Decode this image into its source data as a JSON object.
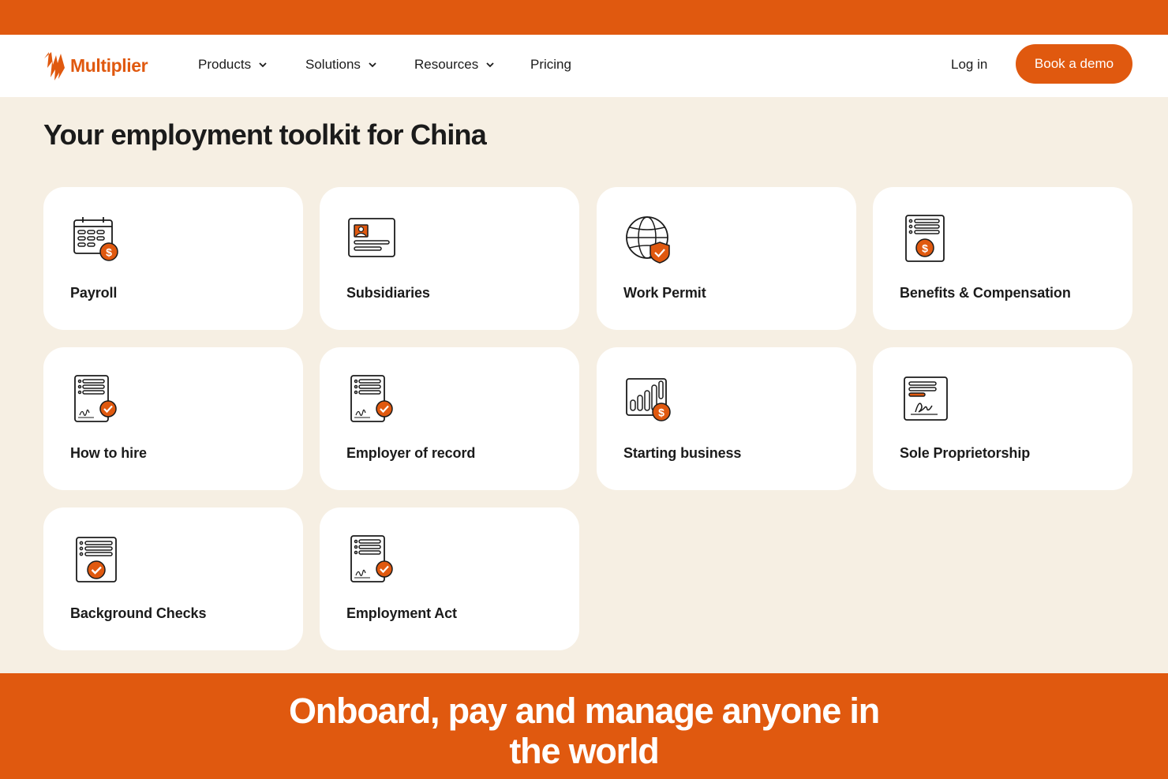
{
  "brand": {
    "name": "Multiplier",
    "accent": "#e0590f",
    "background": "#f6efe3"
  },
  "nav": {
    "items": [
      {
        "label": "Products",
        "has_dropdown": true
      },
      {
        "label": "Solutions",
        "has_dropdown": true
      },
      {
        "label": "Resources",
        "has_dropdown": true
      },
      {
        "label": "Pricing",
        "has_dropdown": false
      }
    ],
    "login": "Log in",
    "cta": "Book a demo"
  },
  "toolkit": {
    "title": "Your employment toolkit for China",
    "cards": [
      {
        "label": "Payroll",
        "icon": "payroll-calendar-icon"
      },
      {
        "label": "Subsidiaries",
        "icon": "id-card-icon"
      },
      {
        "label": "Work Permit",
        "icon": "globe-shield-icon"
      },
      {
        "label": "Benefits & Compensation",
        "icon": "document-dollar-icon"
      },
      {
        "label": "How to hire",
        "icon": "signed-document-check-icon"
      },
      {
        "label": "Employer of record",
        "icon": "signed-document-check-icon"
      },
      {
        "label": "Starting business",
        "icon": "bar-chart-dollar-icon"
      },
      {
        "label": "Sole Proprietorship",
        "icon": "signature-document-icon"
      },
      {
        "label": "Background Checks",
        "icon": "document-check-icon"
      },
      {
        "label": "Employment Act",
        "icon": "signed-document-check-icon"
      }
    ]
  },
  "footer": {
    "headline_line1": "Onboard, pay and manage anyone in",
    "headline_line2": "the world"
  }
}
